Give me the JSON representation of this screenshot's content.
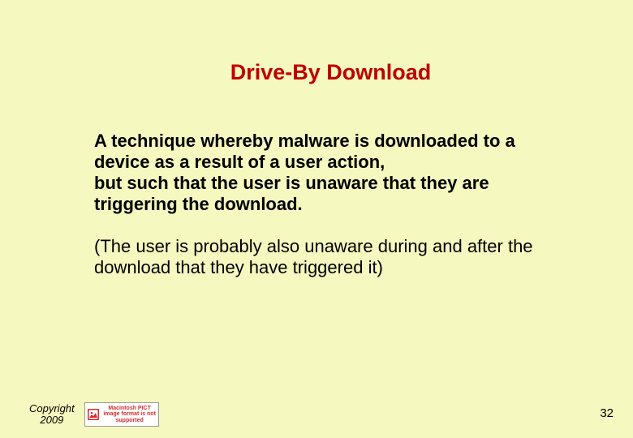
{
  "slide": {
    "title": "Drive-By Download",
    "para1": "A technique whereby malware is downloaded to a device as a result of a user action,\nbut such that the user is unaware that they are triggering the download.",
    "para2": "(The user is probably also unaware during and after the download that they have triggered it)"
  },
  "footer": {
    "copyright_line1": "Copyright",
    "copyright_line2": "2009",
    "broken_text": "Macintosh PICT image format is not supported"
  },
  "page_number": "32"
}
